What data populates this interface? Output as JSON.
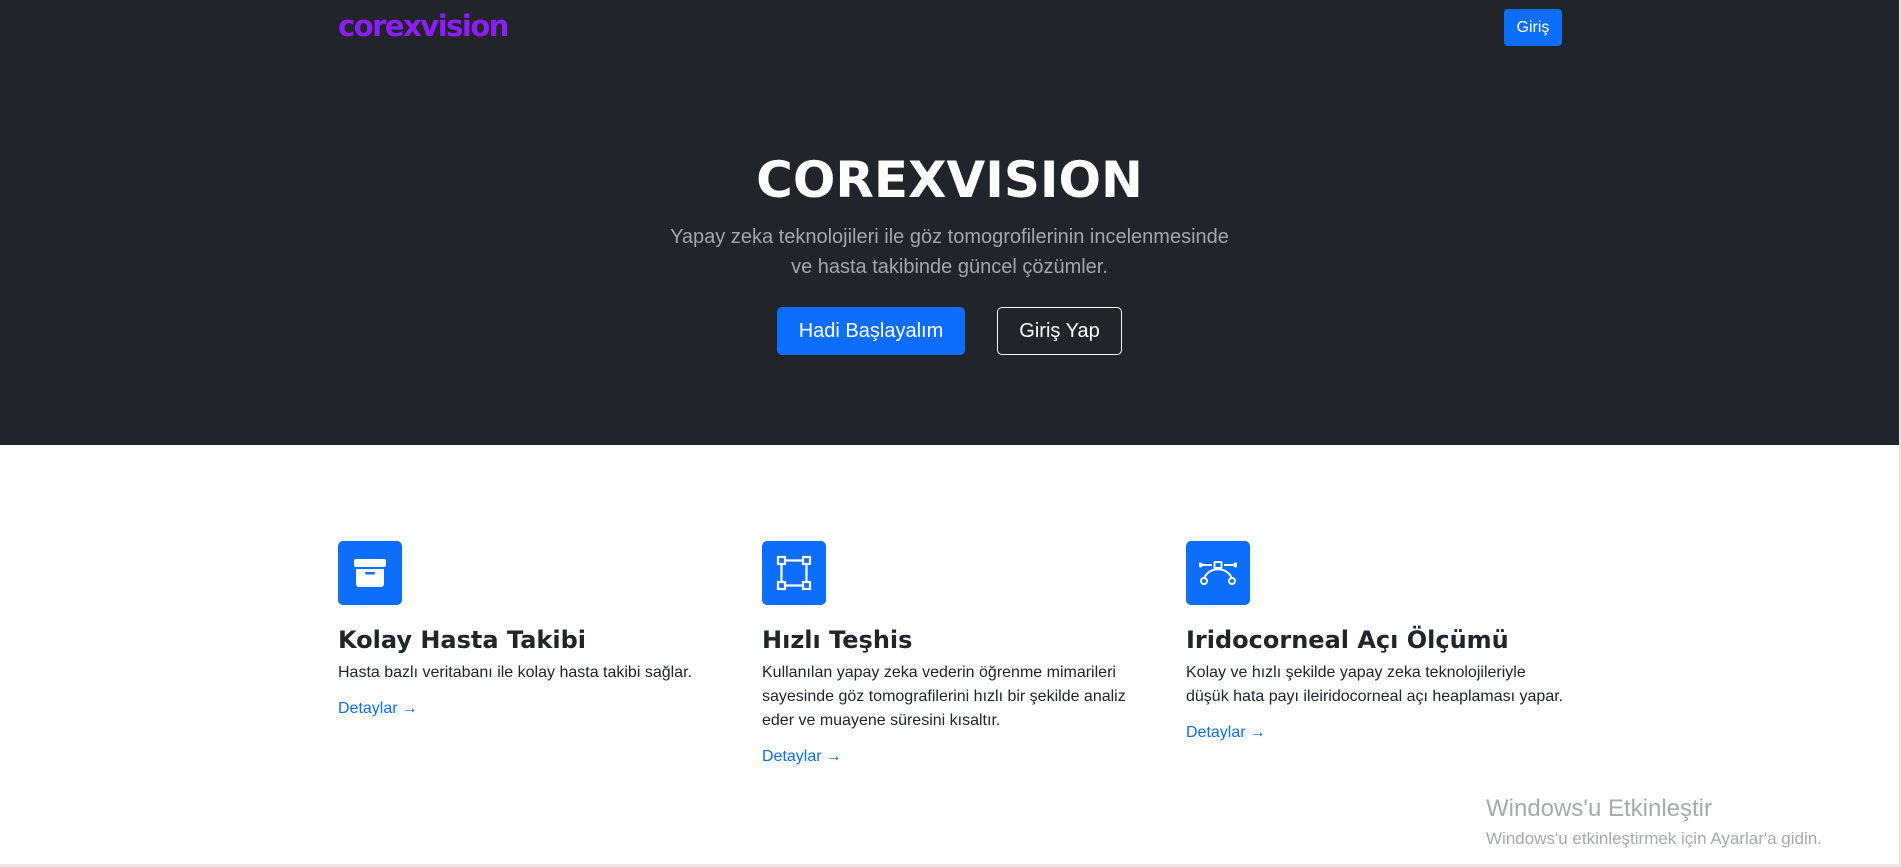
{
  "navbar": {
    "logo": "corexvision",
    "login_button": "Giriş"
  },
  "hero": {
    "title": "COREXVISION",
    "subtitle": "Yapay zeka teknolojileri ile göz tomogrofilerinin incelenmesinde ve hasta takibinde güncel çözümler.",
    "primary_button": "Hadi Başlayalım",
    "secondary_button": "Giriş Yap"
  },
  "features": [
    {
      "icon": "archive-box-icon",
      "title": "Kolay Hasta Takibi",
      "text": "Hasta bazlı veritabanı ile kolay hasta takibi sağlar.",
      "link": "Detaylar"
    },
    {
      "icon": "bounding-box-icon",
      "title": "Hızlı Teşhis",
      "text": "Kullanılan yapay zeka vederin öğrenme mimarileri sayesinde göz tomografilerini hızlı bir şekilde analiz eder ve muayene süresini kısaltır.",
      "link": "Detaylar"
    },
    {
      "icon": "vector-pen-curve-icon",
      "title": "Iridocorneal Açı Ölçümü",
      "text": "Kolay ve hızlı şekilde yapay zeka teknolojileriyle düşük hata payı ileiridocorneal açı heaplaması yapar.",
      "link": "Detaylar"
    }
  ],
  "link_arrow": "→",
  "watermark": {
    "title": "Windows'u Etkinleştir",
    "subtitle": "Windows'u etkinleştirmek için Ayarlar'a gidin."
  },
  "colors": {
    "hero_bg": "#212529",
    "accent": "#0d6efd",
    "logo": "#8d1df5"
  }
}
